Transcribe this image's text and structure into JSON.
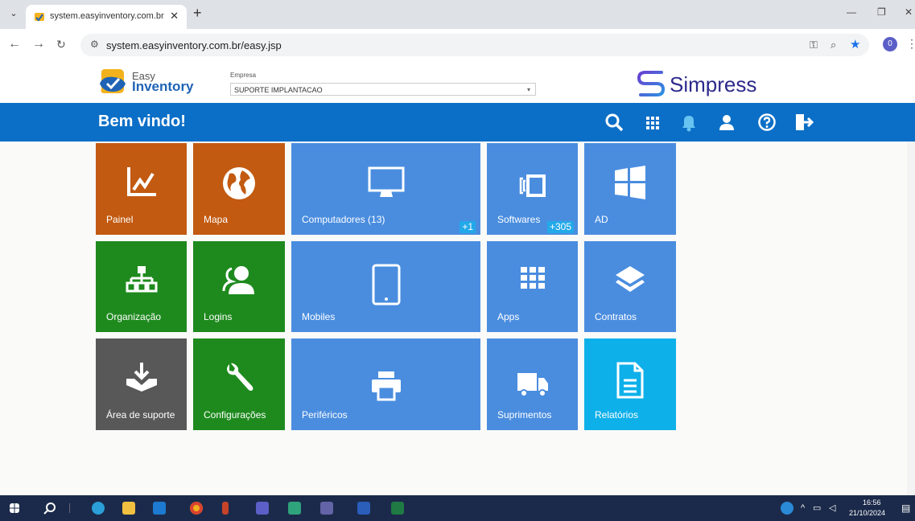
{
  "browser": {
    "tab_title": "system.easyinventory.com.br/e",
    "url": "system.easyinventory.com.br/easy.jsp",
    "profile_initial": "0"
  },
  "header": {
    "logo_line1": "Easy",
    "logo_line2": "Inventory",
    "empresa_label": "Empresa",
    "empresa_value": "SUPORTE IMPLANTACAO",
    "brand": "Simpress"
  },
  "bar": {
    "welcome": "Bem vindo!"
  },
  "tiles": [
    {
      "label": "Painel",
      "icon": "chart-line-icon",
      "color": "#c25a11"
    },
    {
      "label": "Mapa",
      "icon": "globe-icon",
      "color": "#c25a11"
    },
    {
      "label": "Computadores (13)",
      "icon": "monitor-icon",
      "color": "#4a8ddf",
      "badge": "+1"
    },
    {
      "label": "Softwares",
      "icon": "software-icon",
      "color": "#4a8ddf",
      "badge": "+305"
    },
    {
      "label": "AD",
      "icon": "windows-icon",
      "color": "#4a8ddf"
    },
    {
      "label": "Organização",
      "icon": "org-chart-icon",
      "color": "#1e8a1e"
    },
    {
      "label": "Logins",
      "icon": "users-icon",
      "color": "#1e8a1e"
    },
    {
      "label": "Mobiles",
      "icon": "tablet-icon",
      "color": "#4a8ddf"
    },
    {
      "label": "Apps",
      "icon": "apps-grid-icon",
      "color": "#4a8ddf"
    },
    {
      "label": "Contratos",
      "icon": "layers-icon",
      "color": "#4a8ddf"
    },
    {
      "label": "Área de suporte",
      "icon": "download-tray-icon",
      "color": "#585858"
    },
    {
      "label": "Configurações",
      "icon": "wrench-icon",
      "color": "#1e8a1e"
    },
    {
      "label": "Periféricos",
      "icon": "printer-icon",
      "color": "#4a8ddf"
    },
    {
      "label": "Suprimentos",
      "icon": "truck-icon",
      "color": "#4a8ddf"
    },
    {
      "label": "Relatórios",
      "icon": "document-icon",
      "color": "#0eb0ea"
    }
  ],
  "taskbar": {
    "time": "16:56",
    "date": "21/10/2024"
  }
}
